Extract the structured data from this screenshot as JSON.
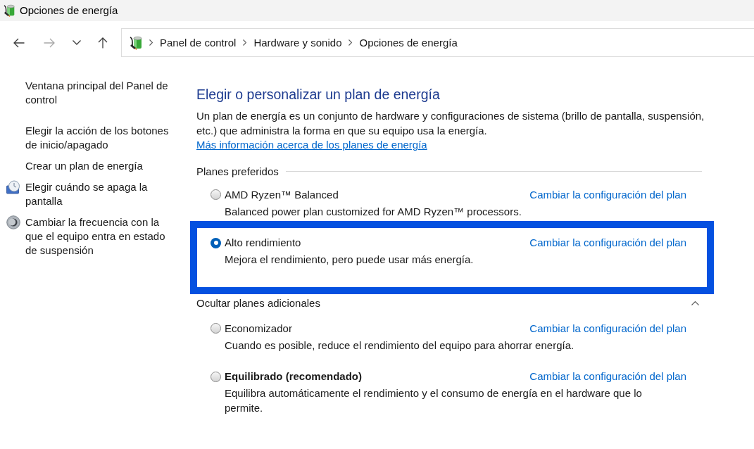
{
  "window": {
    "title": "Opciones de energía"
  },
  "nav_buttons": [
    {
      "kind": "back",
      "disabled": false
    },
    {
      "kind": "forward",
      "disabled": true
    },
    {
      "kind": "recent",
      "disabled": false
    },
    {
      "kind": "up",
      "disabled": false
    }
  ],
  "address_bar": {
    "breadcrumbs": [
      "Panel de control",
      "Hardware y sonido",
      "Opciones de energía"
    ]
  },
  "sidebar": {
    "sections": [
      {
        "items": [
          {
            "kind": "link",
            "label": "Ventana principal del Panel de control"
          }
        ]
      },
      {
        "items": [
          {
            "kind": "link",
            "label": "Elegir la acción de los botones de inicio/apagado"
          },
          {
            "kind": "link",
            "label": "Crear un plan de energía"
          },
          {
            "kind": "display",
            "label": "Elegir cuándo se apaga la pantalla"
          },
          {
            "kind": "sleep",
            "label": "Cambiar la frecuencia con la que el equipo entra en estado de suspensión"
          }
        ]
      }
    ]
  },
  "main": {
    "heading": "Elegir o personalizar un plan de energía",
    "intro": {
      "text": "Un plan de energía es un conjunto de hardware y configuraciones de sistema (brillo de pantalla, suspensión, etc.) que administra la forma en que su equipo usa la energía.",
      "link": "Más información acerca de los planes de energía"
    },
    "preferred_plans": {
      "label": "Planes preferidos",
      "plans": [
        {
          "name": "AMD Ryzen™ Balanced",
          "description": "Balanced power plan customized for AMD Ryzen™ processors.",
          "link": "Cambiar la configuración del plan",
          "selected": false,
          "recommended": false,
          "highlighted": false
        },
        {
          "name": "Alto rendimiento",
          "description": "Mejora el rendimiento, pero puede usar más energía.",
          "link": "Cambiar la configuración del plan",
          "selected": true,
          "recommended": false,
          "highlighted": true
        }
      ]
    },
    "additional_plans": {
      "label": "Ocultar planes adicionales",
      "expanded": true,
      "plans": [
        {
          "name": "Economizador",
          "description": "Cuando es posible, reduce el rendimiento del equipo para ahorrar energía.",
          "link": "Cambiar la configuración del plan",
          "selected": false,
          "recommended": false,
          "highlighted": false
        },
        {
          "name": "Equilibrado (recomendado)",
          "description": "Equilibra automáticamente el rendimiento y el consumo de energía en el hardware que lo permite.",
          "link": "Cambiar la configuración del plan",
          "selected": false,
          "recommended": true,
          "highlighted": false
        }
      ]
    }
  }
}
